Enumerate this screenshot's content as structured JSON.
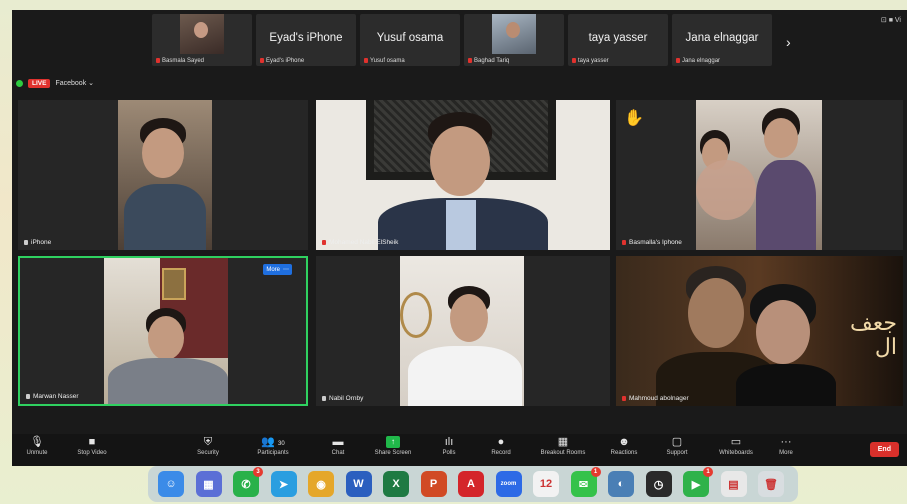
{
  "participants_strip": [
    {
      "name": "",
      "sub": "Basmala Sayed",
      "has_video": true
    },
    {
      "name": "Eyad's iPhone",
      "sub": "Eyad's iPhone",
      "has_video": false
    },
    {
      "name": "Yusuf osama",
      "sub": "Yusuf osama",
      "has_video": false
    },
    {
      "name": "",
      "sub": "Baghad Tariq",
      "has_video": true
    },
    {
      "name": "taya yasser",
      "sub": "taya yasser",
      "has_video": false
    },
    {
      "name": "Jana elnaggar",
      "sub": "Jana elnaggar",
      "has_video": false
    }
  ],
  "strip_next_icon": "›",
  "top_right": {
    "view_label": "Vi"
  },
  "live": {
    "badge": "LIVE",
    "platform": "Facebook ⌄"
  },
  "tiles": [
    {
      "label": "iPhone"
    },
    {
      "label": "Mohamed Nabil ElSheik"
    },
    {
      "label": "Basmalla's Iphone"
    },
    {
      "label": "Marwan Nasser",
      "more": "More"
    },
    {
      "label": "Nabil Ornby"
    },
    {
      "label": "Mahmoud abolnager",
      "overlay_text": "جعف\nال"
    }
  ],
  "toolbar": {
    "unmute": "Unmute",
    "stop_video": "Stop Video",
    "security": "Security",
    "participants": "Participants",
    "participants_count": "30",
    "chat": "Chat",
    "share_screen": "Share Screen",
    "polls": "Polls",
    "record": "Record",
    "breakout": "Breakout Rooms",
    "reactions": "Reactions",
    "support": "Support",
    "whiteboards": "Whiteboards",
    "more": "More",
    "end": "End"
  },
  "dock": {
    "apps": [
      {
        "name": "finder-icon",
        "color": "#3b8be8",
        "glyph": "☺"
      },
      {
        "name": "launchpad-icon",
        "color": "#5b6fd6",
        "glyph": "▦"
      },
      {
        "name": "whatsapp-icon",
        "color": "#29b14a",
        "glyph": "✆",
        "badge": "3"
      },
      {
        "name": "telegram-icon",
        "color": "#2a9ee0",
        "glyph": "➤"
      },
      {
        "name": "chrome-icon",
        "color": "#e5a72a",
        "glyph": "◉"
      },
      {
        "name": "word-icon",
        "color": "#2b5fbf",
        "glyph": "W"
      },
      {
        "name": "excel-icon",
        "color": "#1f7a43",
        "glyph": "X"
      },
      {
        "name": "powerpoint-icon",
        "color": "#d14a24",
        "glyph": "P"
      },
      {
        "name": "acrobat-icon",
        "color": "#d4252a",
        "glyph": "A"
      },
      {
        "name": "zoom-icon",
        "color": "#2d6ae6",
        "glyph": "zoom"
      },
      {
        "name": "calendar-icon",
        "color": "#f2f2f2",
        "glyph": "12"
      },
      {
        "name": "messages-icon",
        "color": "#35c24a",
        "glyph": "✉",
        "badge": "1"
      },
      {
        "name": "screen-share-icon",
        "color": "#4a7fb5",
        "glyph": "◐"
      },
      {
        "name": "clock-icon",
        "color": "#2a2a2a",
        "glyph": "◷"
      },
      {
        "name": "facetime-icon",
        "color": "#2fb24a",
        "glyph": "▶",
        "badge": "1"
      },
      {
        "name": "preview-icon",
        "color": "#e8e8e8",
        "glyph": "▤"
      },
      {
        "name": "trash-icon",
        "color": "#d8dde0",
        "glyph": "🗑"
      }
    ]
  },
  "colors": {
    "live": "#e0322e",
    "active_border": "#2fd160",
    "share": "#20b84a",
    "end": "#d9302b"
  }
}
